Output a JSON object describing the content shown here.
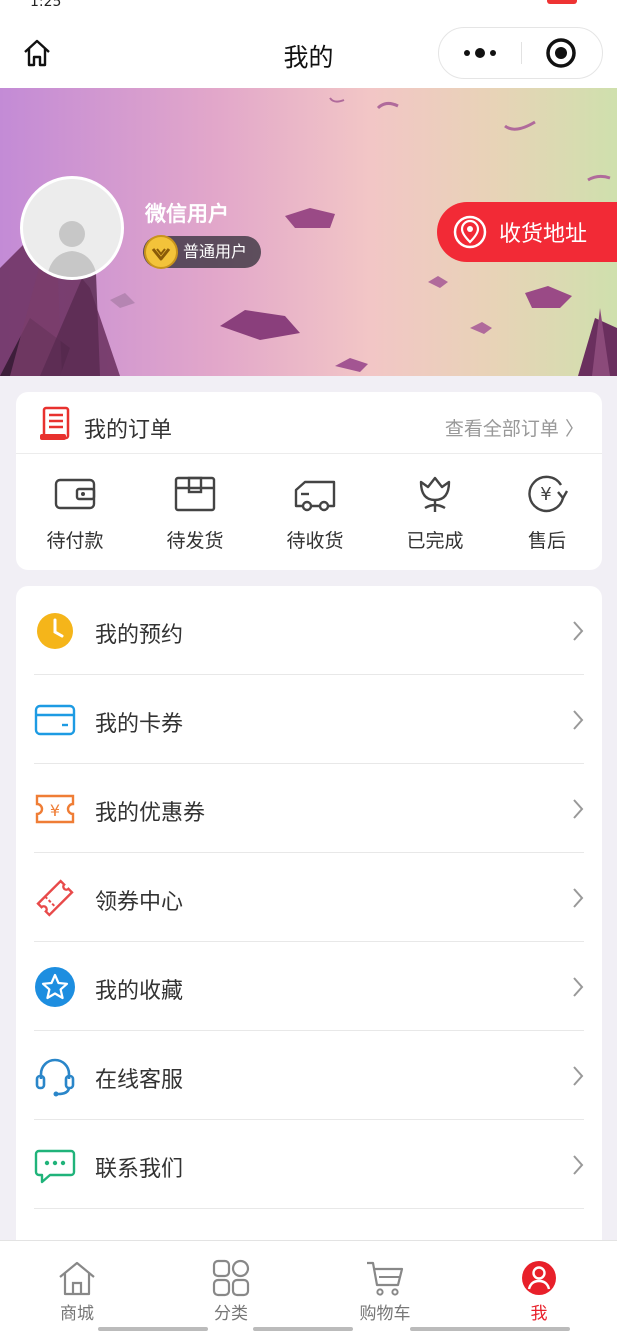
{
  "statusbar": {
    "time": "1:25"
  },
  "navbar": {
    "title": "我的"
  },
  "profile": {
    "username": "微信用户",
    "level": "普通用户",
    "address_button": "收货地址"
  },
  "orders": {
    "title": "我的订单",
    "view_all": "查看全部订单",
    "items": [
      {
        "label": "待付款",
        "icon": "wallet-icon"
      },
      {
        "label": "待发货",
        "icon": "package-icon"
      },
      {
        "label": "待收货",
        "icon": "truck-icon"
      },
      {
        "label": "已完成",
        "icon": "flower-icon"
      },
      {
        "label": "售后",
        "icon": "yen-refund-icon"
      }
    ]
  },
  "menu": [
    {
      "label": "我的预约",
      "icon": "clock-icon",
      "color": "#f5b51a"
    },
    {
      "label": "我的卡券",
      "icon": "card-icon",
      "color": "#1d9be3"
    },
    {
      "label": "我的优惠券",
      "icon": "coupon-icon",
      "color": "#ef7d35"
    },
    {
      "label": "领券中心",
      "icon": "ticket-icon",
      "color": "#e84a4a"
    },
    {
      "label": "我的收藏",
      "icon": "star-icon",
      "color": "#1d8ee0"
    },
    {
      "label": "在线客服",
      "icon": "headset-icon",
      "color": "#2a86c9"
    },
    {
      "label": "联系我们",
      "icon": "chat-icon",
      "color": "#20b37a"
    }
  ],
  "tabbar": [
    {
      "label": "商城",
      "icon": "home-icon",
      "active": false
    },
    {
      "label": "分类",
      "icon": "grid-icon",
      "active": false
    },
    {
      "label": "购物车",
      "icon": "cart-icon",
      "active": false
    },
    {
      "label": "我",
      "icon": "user-icon",
      "active": true
    }
  ],
  "colors": {
    "accent": "#f22a36",
    "active_tab": "#e8202a"
  }
}
